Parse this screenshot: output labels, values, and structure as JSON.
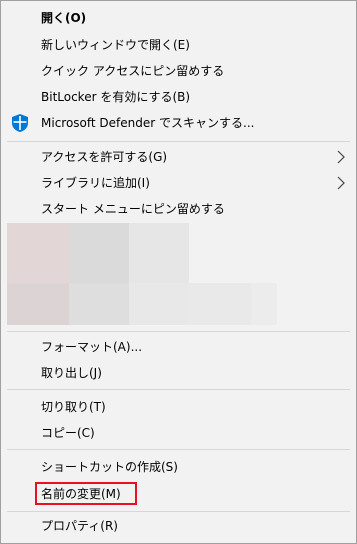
{
  "menu": {
    "items": [
      {
        "label": "開く(O)",
        "bold": true
      },
      {
        "label": "新しいウィンドウで開く(E)"
      },
      {
        "label": "クイック アクセスにピン留めする"
      },
      {
        "label": "BitLocker を有効にする(B)"
      },
      {
        "label": "Microsoft Defender でスキャンする...",
        "icon": "defender-shield-icon"
      },
      {
        "label": "アクセスを許可する(G)",
        "submenu": true
      },
      {
        "label": "ライブラリに追加(I)",
        "submenu": true
      },
      {
        "label": "スタート メニューにピン留めする"
      },
      {
        "label": "フォーマット(A)..."
      },
      {
        "label": "取り出し(J)"
      },
      {
        "label": "切り取り(T)"
      },
      {
        "label": "コピー(C)"
      },
      {
        "label": "ショートカットの作成(S)"
      },
      {
        "label": "名前の変更(M)",
        "highlighted": true
      },
      {
        "label": "プロパティ(R)"
      }
    ]
  },
  "colors": {
    "background": "#f2f2f2",
    "separator": "#d7d7d7",
    "highlight_border": "#e81123",
    "shield_blue": "#0078d7",
    "chevron": "#444444"
  }
}
